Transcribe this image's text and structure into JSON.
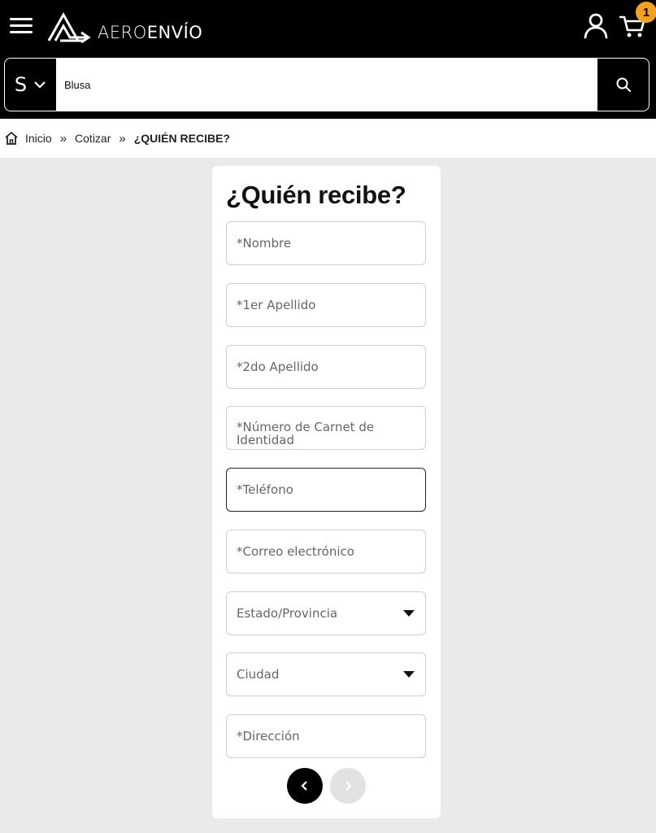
{
  "header": {
    "brand_light": "AERO",
    "brand_bold": "ENVÍO",
    "cart_count": "1",
    "accent_color": "#f4a21d"
  },
  "search": {
    "category_letter": "S",
    "value": "Blusa",
    "icons": {
      "menu": "hamburger-icon",
      "user": "user-icon",
      "cart": "cart-icon",
      "search": "search-icon",
      "dropdown": "chevron-down-icon"
    }
  },
  "breadcrumb": {
    "items": [
      "Inicio",
      "Cotizar",
      "¿QUIÉN RECIBE?"
    ],
    "separator": "»"
  },
  "form": {
    "title": "¿Quién recibe?",
    "fields": [
      "*Nombre",
      "*1er Apellido",
      "*2do Apellido",
      "*Número de Carnet de Identidad",
      "*Teléfono",
      "*Correo electrónico",
      "Estado/Provincia",
      "Ciudad",
      "*Dirección"
    ],
    "focused_field": "*Teléfono"
  }
}
